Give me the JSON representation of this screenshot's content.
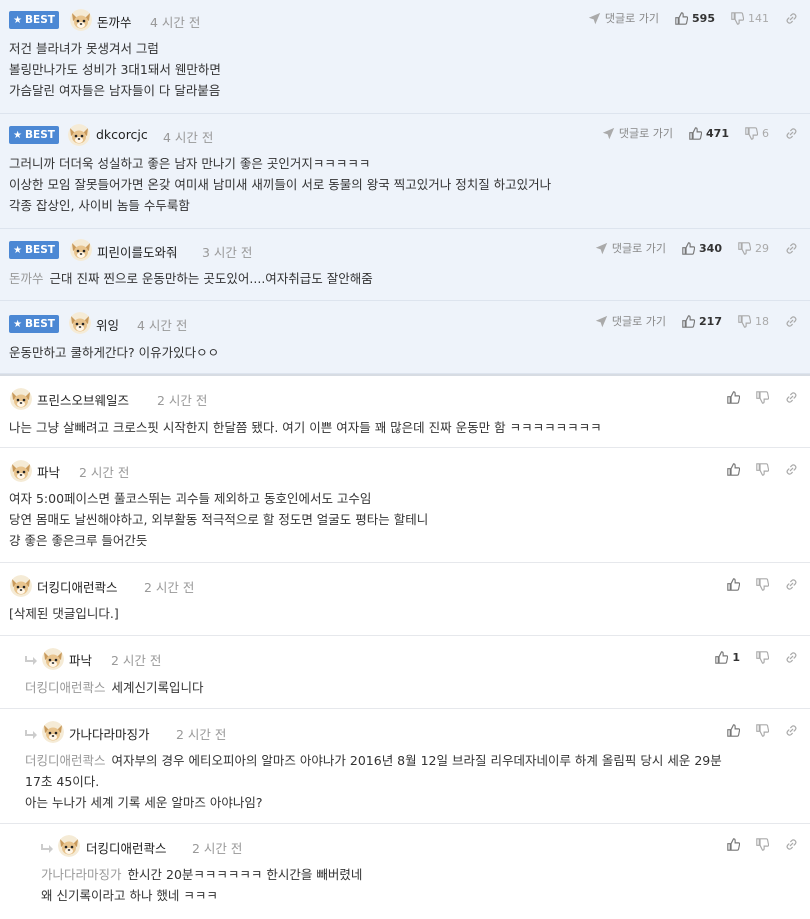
{
  "best_badge": "BEST",
  "reply_link_label": "댓글로 가기",
  "comments": [
    {
      "nick": "돈까쑤",
      "time": "4 시간 전",
      "up": "595",
      "down": "141",
      "lines": [
        "저건 블라녀가 못생겨서 그럼",
        "볼링만나가도 성비가 3대1돼서 웬만하면",
        "가슴달린 여자들은 남자들이 다 달라붙음"
      ]
    },
    {
      "nick": "dkcorcjc",
      "time": "4 시간 전",
      "up": "471",
      "down": "6",
      "lines": [
        "그러니까 더더욱 성실하고 좋은 남자 만나기 좋은 곳인거지ㅋㅋㅋㅋㅋ",
        "이상한 모임 잘못들어가면 온갖 여미새 남미새 새끼들이 서로 동물의 왕국 찍고있거나 정치질 하고있거나",
        "각종 잡상인, 사이비 놈들 수두룩함"
      ]
    },
    {
      "nick": "피린이를도와줘",
      "time": "3 시간 전",
      "up": "340",
      "down": "29",
      "mention": "돈까쑤",
      "lines": [
        "근대 진짜 찐으로 운동만하는 곳도있어....여자취급도 잘안해줌"
      ]
    },
    {
      "nick": "위잉",
      "time": "4 시간 전",
      "up": "217",
      "down": "18",
      "lines": [
        "운동만하고 쿨하게간다? 이유가있다ㅇㅇ"
      ]
    },
    {
      "nick": "프린스오브웨일즈",
      "time": "2 시간 전",
      "lines": [
        "나는 그냥 살빼려고 크로스핏 시작한지 한달쯤 됐다. 여기 이쁜 여자들 꽤 많은데 진짜 운동만 함 ㅋㅋㅋㅋㅋㅋㅋㅋ"
      ]
    },
    {
      "nick": "파낙",
      "time": "2 시간 전",
      "lines": [
        "여자 5:00페이스면 풀코스뛰는 괴수들 제외하고 동호인에서도 고수임",
        "당연 몸매도 날씬해야하고, 외부활동 적극적으로 할 정도면 얼굴도 평타는 할테니",
        "걍 좋은 좋은크루 들어간듯"
      ]
    },
    {
      "nick": "더킹디애런콱스",
      "time": "2 시간 전",
      "lines": [
        "[삭제된 댓글입니다.]"
      ]
    },
    {
      "nick": "파낙",
      "time": "2 시간 전",
      "up": "1",
      "mention": "더킹디애런콱스",
      "lines": [
        "세계신기록입니다"
      ]
    },
    {
      "nick": "가나다라마징가",
      "time": "2 시간 전",
      "mention": "더킹디애런콱스",
      "lines": [
        "여자부의 경우 에티오피아의 알마즈 아야나가 2016년 8월 12일 브라질 리우데자네이루 하계 올림픽 당시 세운 29분",
        "17초 45이다.",
        "아는 누나가 세계 기록 세운 알마즈 아야나임?"
      ]
    },
    {
      "nick": "더킹디애런콱스",
      "time": "2 시간 전",
      "mention": "가나다라마징가",
      "lines": [
        "한시간 20분ㅋㅋㅋㅋㅋㅋ 한시간을 빼버렸네",
        "왜 신기록이라고 하나 했네 ㅋㅋㅋ"
      ]
    }
  ],
  "colors": {
    "best_badge": "#4c88d4",
    "best_bg": "#eef3fa",
    "mention": "#999999",
    "time": "#999999"
  },
  "icons": {
    "reply": "paper-plane-icon",
    "up": "thumbs-up-icon",
    "down": "thumbs-down-icon",
    "link": "link-icon",
    "avatar": "dog-avatar-icon",
    "reply_arrow": "reply-arrow-icon"
  }
}
